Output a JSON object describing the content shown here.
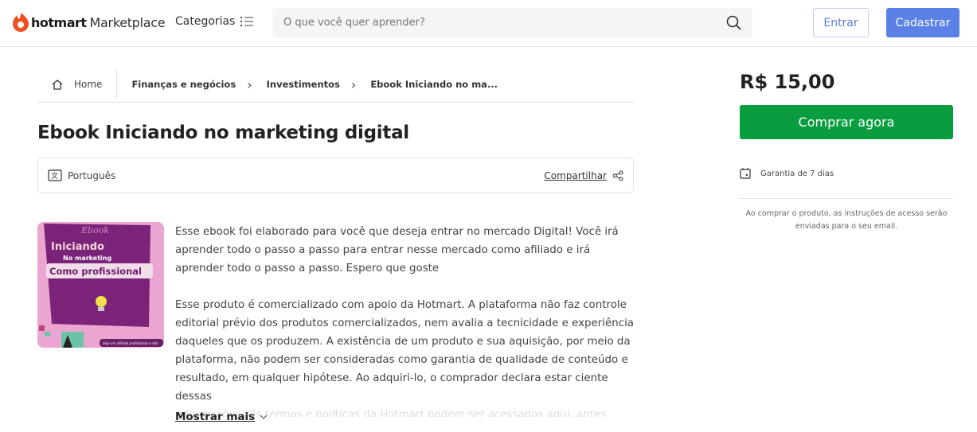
{
  "header": {
    "logo_brand": "hotmart",
    "logo_suffix": "Marketplace",
    "categories_label": "Categorias",
    "search_placeholder": "O que você quer aprender?",
    "login_label": "Entrar",
    "signup_label": "Cadastrar"
  },
  "breadcrumb": {
    "home": "Home",
    "items": [
      "Finanças e negócios",
      "Investimentos",
      "Ebook Iniciando no ma..."
    ]
  },
  "product": {
    "title": "Ebook Iniciando no marketing digital",
    "language": "Português",
    "share_label": "Compartilhar",
    "cover_text": {
      "line1": "Ebook",
      "line2": "Iniciando",
      "line3": "No marketing",
      "line4": "Como profissional",
      "footer": "Seja um afiliado profissional e não"
    },
    "description": [
      "Esse ebook foi elaborado para você que deseja entrar no mercado Digital! Você irá aprender todo o passo a passo para entrar nesse mercado como afiliado e irá aprender todo o passo a passo. Espero que goste",
      "Esse produto é comercializado com apoio da Hotmart. A plataforma não faz controle editorial prévio dos produtos comercializados, nem avalia a tecnicidade e experiência daqueles que os produzem. A existência de um produto e sua aquisição, por meio da plataforma, não podem ser consideradas como garantia de qualidade de conteúdo e resultado, em qualquer hipótese. Ao adquiri-lo, o comprador declara estar ciente dessas"
    ],
    "description_faded": "informações. Os termos e políticas da Hotmart podem ser acessados aqui, antes mesmo",
    "show_more": "Mostrar mais"
  },
  "purchase": {
    "price": "R$ 15,00",
    "buy_label": "Comprar agora",
    "guarantee": "Garantia de 7 dias",
    "note": "Ao comprar o produto, as instruções de acesso serão enviadas para o seu email."
  }
}
